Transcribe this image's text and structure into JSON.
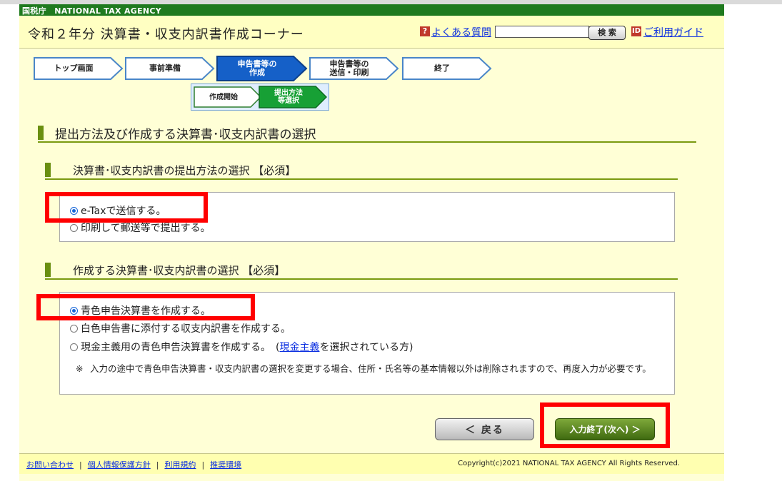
{
  "agency_bar": "国税庁　NATIONAL TAX AGENCY",
  "header": {
    "title": "令和２年分 決算書・収支内訳書作成コーナー",
    "faq_icon": "?",
    "faq_link": "よくある質問",
    "search_value": "",
    "search_button": "検 索",
    "guide_icon": "ID",
    "guide_link": "ご利用ガイド"
  },
  "steps": {
    "top": "トップ画面",
    "prep": "事前準備",
    "create_l1": "申告書等の",
    "create_l2": "作成",
    "send_l1": "申告書等の",
    "send_l2": "送信・印刷",
    "end": "終了",
    "sub_start": "作成開始",
    "sub_method_l1": "提出方法",
    "sub_method_l2": "等選択"
  },
  "main": {
    "heading": "提出方法及び作成する決算書･収支内訳書の選択",
    "section1": {
      "heading": "決算書･収支内訳書の提出方法の選択 【必須】",
      "option1": "e-Taxで送信する。",
      "option2": "印刷して郵送等で提出する。"
    },
    "section2": {
      "heading": "作成する決算書･収支内訳書の選択 【必須】",
      "option1": "青色申告決算書を作成する。",
      "option2": "白色申告書に添付する収支内訳書を作成する。",
      "option3_pre": "現金主義用の青色申告決算書を作成する。　(",
      "option3_link": "現金主義",
      "option3_post": "を選択されている方)",
      "note_mark": "※",
      "note": "入力の途中で青色申告決算書・収支内訳書の選択を変更する場合、住所・氏名等の基本情報以外は削除されますので、再度入力が必要です。"
    }
  },
  "buttons": {
    "back": "＜ 戻る",
    "next": "入力終了(次へ) ＞"
  },
  "footer": {
    "links": [
      "お問い合わせ",
      "個人情報保護方針",
      "利用規約",
      "推奨環境"
    ],
    "separator": "|",
    "copyright": "Copyright(c)2021 NATIONAL TAX AGENCY All Rights Reserved."
  },
  "colors": {
    "agency_green": "#1f7a1f",
    "page_bg": "#ffffd6",
    "section_bar": "#6a8f10",
    "active_step": "#1560c8",
    "highlight_red": "#ff0000"
  }
}
